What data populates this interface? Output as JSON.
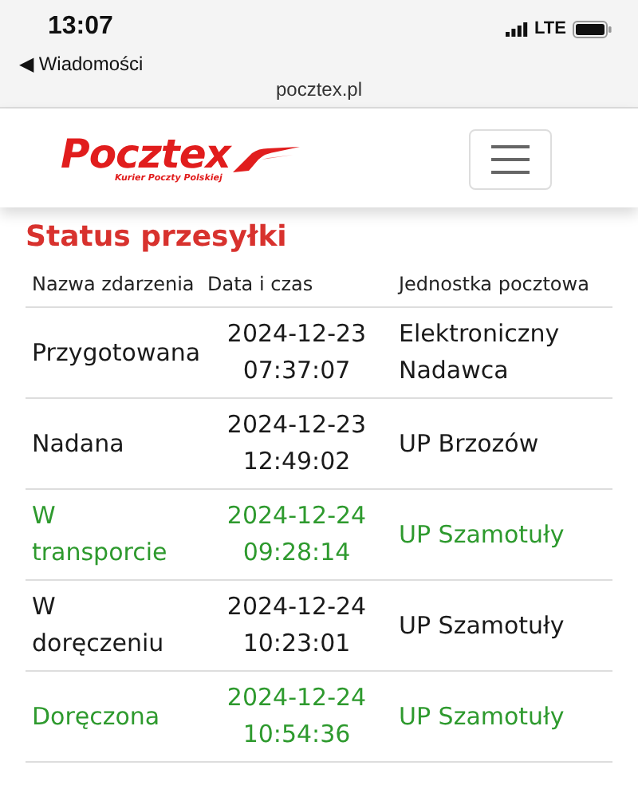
{
  "status_bar": {
    "time": "13:07",
    "back_label": "◀ Wiadomości",
    "network": "LTE"
  },
  "address_bar": {
    "url": "pocztex.pl"
  },
  "header": {
    "logo_text": "Pocztex",
    "logo_subtitle": "Kurier Poczty Polskiej"
  },
  "title": "Status przesyłki",
  "table": {
    "columns": [
      "Nazwa zdarzenia",
      "Data i czas",
      "Jednostka pocztowa"
    ],
    "rows": [
      {
        "event": "Przygotowana",
        "date": "2024-12-23",
        "time": "07:37:07",
        "unit": "Elektroniczny Nadawca",
        "color": "#1a1a1a"
      },
      {
        "event": "Nadana",
        "date": "2024-12-23",
        "time": "12:49:02",
        "unit": "UP Brzozów",
        "color": "#1a1a1a"
      },
      {
        "event": "W transporcie",
        "date": "2024-12-24",
        "time": "09:28:14",
        "unit": "UP Szamotuły",
        "color": "#2e9a2e"
      },
      {
        "event": "W doręczeniu",
        "date": "2024-12-24",
        "time": "10:23:01",
        "unit": "UP Szamotuły",
        "color": "#1a1a1a"
      },
      {
        "event": "Doręczona",
        "date": "2024-12-24",
        "time": "10:54:36",
        "unit": "UP Szamotuły",
        "color": "#2e9a2e"
      }
    ]
  }
}
